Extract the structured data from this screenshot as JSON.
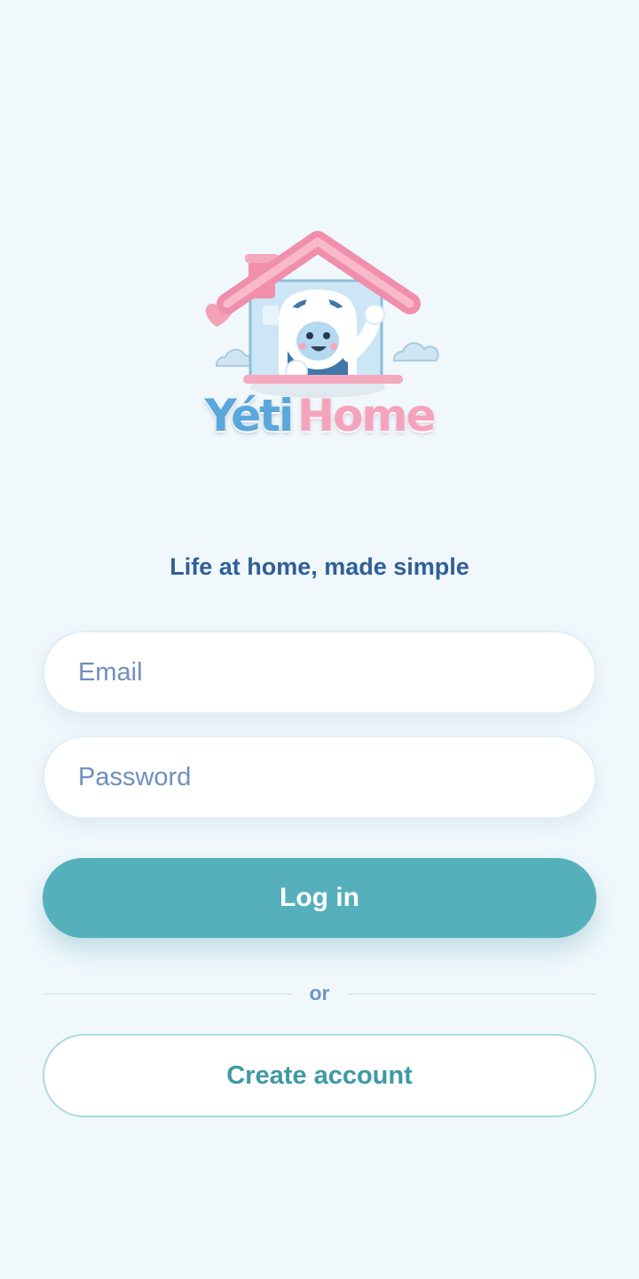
{
  "logo": {
    "word_1": "Yéti",
    "word_2": "Home",
    "illustration": "yeti-house-icon"
  },
  "tagline": "Life at home, made simple",
  "form": {
    "email_placeholder": "Email",
    "password_placeholder": "Password",
    "login_label": "Log in",
    "divider_text": "or",
    "create_account_label": "Create account"
  },
  "colors": {
    "background": "#f0f8fc",
    "primary": "#55b0bb",
    "tagline": "#2f5f96",
    "placeholder": "#6d8fbd",
    "logo_blue": "#5aa7dc",
    "logo_pink": "#f5a3bd"
  }
}
